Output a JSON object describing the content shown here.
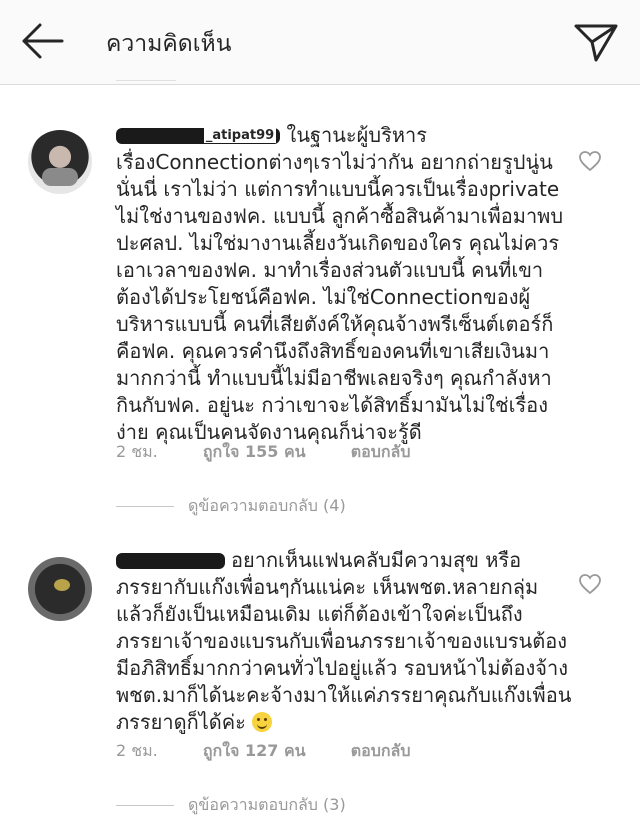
{
  "header": {
    "title": "ความคิดเห็น",
    "back_icon": "arrow-left-icon",
    "send_icon": "send-icon"
  },
  "comments": [
    {
      "username": "_atipat99",
      "text": "ในฐานะผู้บริหาร เรื่องConnectionต่างๆเราไม่ว่ากัน อยากถ่ายรูปนู่นนั่นนี่ เราไม่ว่า แต่การทำแบบนี้ควรเป็นเรื่องprivate ไม่ใช่งานของฟค. แบบนี้ ลูกค้าซื้อสินค้ามาเพื่อมาพบปะศลป. ไม่ใช่มางานเลี้ยงวันเกิดของใคร คุณไม่ควรเอาเวลาของฟค. มาทำเรื่องส่วนตัวแบบนี้ คนที่เขาต้องได้ประโยชน์คือฟค. ไม่ใช่Connectionของผู้บริหารแบบนี้ คนที่เสียตังค์ให้คุณจ้างพรีเซ็นต์เตอร์ก็คือฟค. คุณควรคำนึงถึงสิทธิ์ของคนที่เขาเสียเงินมามากกว่านี้ ทำแบบนี้ไม่มีอาชีพเลยจริงๆ คุณกำลังหากินกับฟค. อยู่นะ กว่าเขาจะได้สิทธิ์มามันไม่ใช่เรื่องง่าย คุณเป็นคนจัดงานคุณก็น่าจะรู้ดี",
      "time": "2 ชม.",
      "likes": "ถูกใจ 155 คน",
      "reply_label": "ตอบกลับ",
      "view_replies": "ดูข้อความตอบกลับ (4)"
    },
    {
      "username": "",
      "text": "อยากเห็นแฟนคลับมีความสุข หรือภรรยากับแก๊งเพื่อนๆกันแน่คะ เห็นพชต.หลายกลุ่มแล้วก็ยังเป็นเหมือนเดิม แต่ก็ต้องเข้าใจค่ะเป็นถึงภรรยาเจ้าของแบรนกับเพื่อนภรรยาเจ้าของแบรนต้องมีอภิสิทธิ์มากกว่าคนทั่วไปอยู่แล้ว รอบหน้าไม่ต้องจ้างพชต.มาก็ได้นะคะจ้างมาให้แค่ภรรยาคุณกับแก๊งเพื่อนภรรยาดูก็ได้ค่ะ ",
      "time": "2 ชม.",
      "likes": "ถูกใจ 127 คน",
      "reply_label": "ตอบกลับ",
      "view_replies": "ดูข้อความตอบกลับ (3)"
    }
  ],
  "icons": {
    "like": "heart-icon",
    "emoji": "smile-emoji-icon"
  }
}
